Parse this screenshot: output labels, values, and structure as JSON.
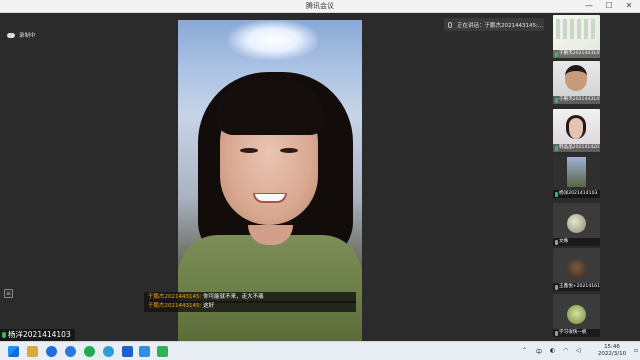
{
  "window": {
    "title": "腾讯会议",
    "min_glyph": "—",
    "max_glyph": "☐",
    "close_glyph": "✕"
  },
  "recording": {
    "label": "录制中",
    "icon": "cloud-icon"
  },
  "speaking": {
    "text": "正在讲话：于鹏杰2021443145;..."
  },
  "chat": [
    {
      "sender": "于鹏杰2021443145:",
      "message": "你可能就不来，走大不痛"
    },
    {
      "sender": "于鹏杰2021443145:",
      "message": "这好"
    }
  ],
  "self_label": "杨洋2021414103",
  "participants": [
    {
      "name": "于鹏杰2021443145的屏幕...",
      "muted": false,
      "kind": "screen"
    },
    {
      "name": "于鹏杰2021443145",
      "muted": false,
      "kind": "video"
    },
    {
      "name": "韩晶晶2021414201",
      "muted": false,
      "kind": "video"
    },
    {
      "name": "杨洋2021414103",
      "muted": false,
      "kind": "video"
    },
    {
      "name": "文殊",
      "muted": true,
      "kind": "avatar"
    },
    {
      "name": "王鑫悦+2021416115",
      "muted": true,
      "kind": "avatar"
    },
    {
      "name": "学习很快一帆",
      "muted": true,
      "kind": "avatar"
    }
  ],
  "taskbar": {
    "tray_lang": "中",
    "time": "15:46",
    "date": "2022/3/10"
  },
  "colors": {
    "accent": "#2ebd59",
    "chat_sender": "#f0a020",
    "background": "#2b2b2b"
  }
}
